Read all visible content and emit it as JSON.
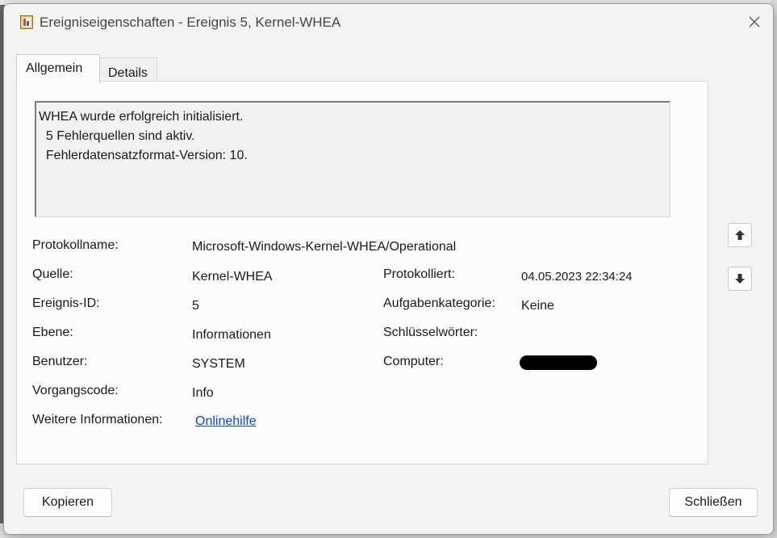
{
  "window": {
    "title": "Ereigniseigenschaften - Ereignis 5, Kernel-WHEA",
    "icon": "event-viewer-icon",
    "close_icon": "close-icon"
  },
  "tabs": [
    {
      "label": "Allgemein",
      "active": true
    },
    {
      "label": "Details",
      "active": false
    }
  ],
  "message": {
    "lines": [
      "WHEA wurde erfolgreich initialisiert.",
      "  5 Fehlerquellen sind aktiv.",
      "  Fehlerdatensatzformat-Version: 10."
    ]
  },
  "fields": {
    "log_name": {
      "label": "Protokollname:",
      "value": "Microsoft-Windows-Kernel-WHEA/Operational"
    },
    "source": {
      "label": "Quelle:",
      "value": "Kernel-WHEA"
    },
    "logged": {
      "label": "Protokolliert:",
      "value": "04.05.2023 22:34:24"
    },
    "event_id": {
      "label": "Ereignis-ID:",
      "value": "5"
    },
    "task_category": {
      "label": "Aufgabenkategorie:",
      "value": "Keine"
    },
    "level": {
      "label": "Ebene:",
      "value": "Informationen"
    },
    "keywords": {
      "label": "Schlüsselwörter:",
      "value": ""
    },
    "user": {
      "label": "Benutzer:",
      "value": "SYSTEM"
    },
    "computer": {
      "label": "Computer:",
      "value": ""
    },
    "opcode": {
      "label": "Vorgangscode:",
      "value": "Info"
    },
    "more_info": {
      "label": "Weitere Informationen:",
      "link": "Onlinehilfe"
    }
  },
  "nav": {
    "up_icon": "arrow-up-icon",
    "down_icon": "arrow-down-icon"
  },
  "buttons": {
    "copy": "Kopieren",
    "close": "Schließen"
  }
}
